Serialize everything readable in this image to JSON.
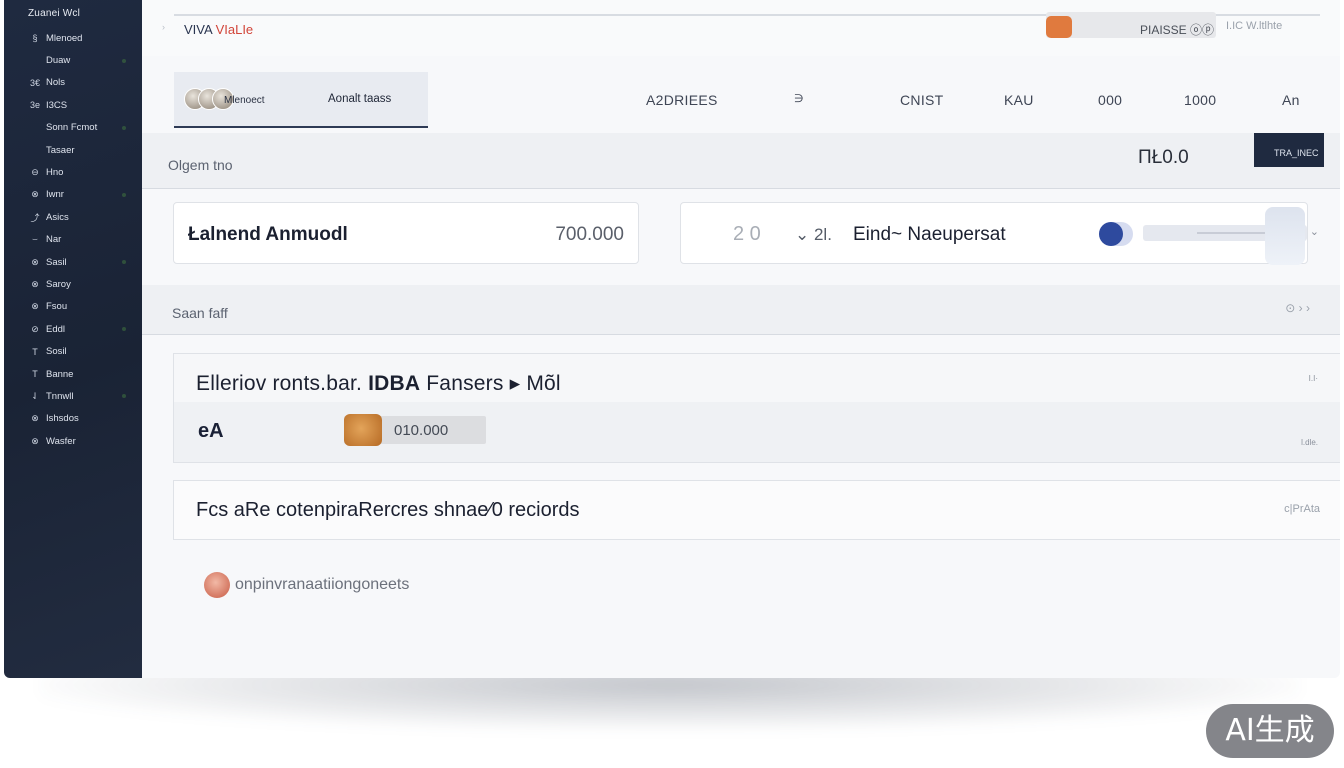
{
  "sidebar": {
    "title": "Zuanei Wcl",
    "items": [
      {
        "icon": "§",
        "label": "Mlenoed"
      },
      {
        "icon": "",
        "label": "Duaw"
      },
      {
        "icon": "3€",
        "label": "Nols"
      },
      {
        "icon": "3e",
        "label": "I3CS"
      },
      {
        "icon": "",
        "label": "Sonn Fcmot"
      },
      {
        "icon": "",
        "label": "Tasaer"
      },
      {
        "icon": "⊖",
        "label": "Hno"
      },
      {
        "icon": "⊗",
        "label": "Iwnr"
      },
      {
        "icon": "⤴",
        "label": "Asics"
      },
      {
        "icon": "⌣",
        "label": "Nar"
      },
      {
        "icon": "⊗",
        "label": "Sasil"
      },
      {
        "icon": "⊗",
        "label": "Saroy"
      },
      {
        "icon": "⊗",
        "label": "Fsou"
      },
      {
        "icon": "⊘",
        "label": "Eddl"
      },
      {
        "icon": "T",
        "label": "Sosil"
      },
      {
        "icon": "T",
        "label": "Banne"
      },
      {
        "icon": "⇃",
        "label": "Tnnwll"
      },
      {
        "icon": "⊗",
        "label": "Ishsdos"
      },
      {
        "icon": "⊗",
        "label": "Wasfer"
      }
    ]
  },
  "topbar": {
    "breadcrumb_lead": "VIVA",
    "breadcrumb": "VIaLIe",
    "search_text": "PIAISSE",
    "search_icon": "ⓞⓟ",
    "right_text": "I.IC W.ltlhte"
  },
  "header": {
    "tab_label": "Aonalt taass",
    "avatar_label": "Mlenoect",
    "columns": [
      "A2DRIEES",
      "∋",
      "CNIST",
      "KAU",
      "000",
      "1000",
      "An"
    ]
  },
  "filter": {
    "label": "Olgem tno",
    "value": "ΠŁ0.0",
    "button": "TRA_INEC"
  },
  "cards": {
    "card1_label": "Łalnend Anmuodl",
    "card1_value": "700.000",
    "card2_num": "2 0",
    "card2_sub": "⌄ 2l.",
    "card2_label": "Eind~ Naeupersat",
    "card2_arrow": "⌄"
  },
  "section": {
    "label": "Saan faff",
    "ctrl": "⊙ › ›"
  },
  "rows": {
    "row1_title_a": "Elleriov ronts.bar.",
    "row1_title_b": "IDBA",
    "row1_title_c": "Fansers ▸ Mõl",
    "row1_icon": "eA",
    "row1_pill_value": "010.000",
    "row1_mini": "I.I·",
    "row1_mini2": "l.dle.",
    "row2_title": "Fcs aRe cotenpiraRercres shnae⁄0 reciords",
    "row2_ctrl": "c|PrAta"
  },
  "footer": {
    "text": "onpinvranaatiiongoneets"
  },
  "watermark": "AI生成"
}
